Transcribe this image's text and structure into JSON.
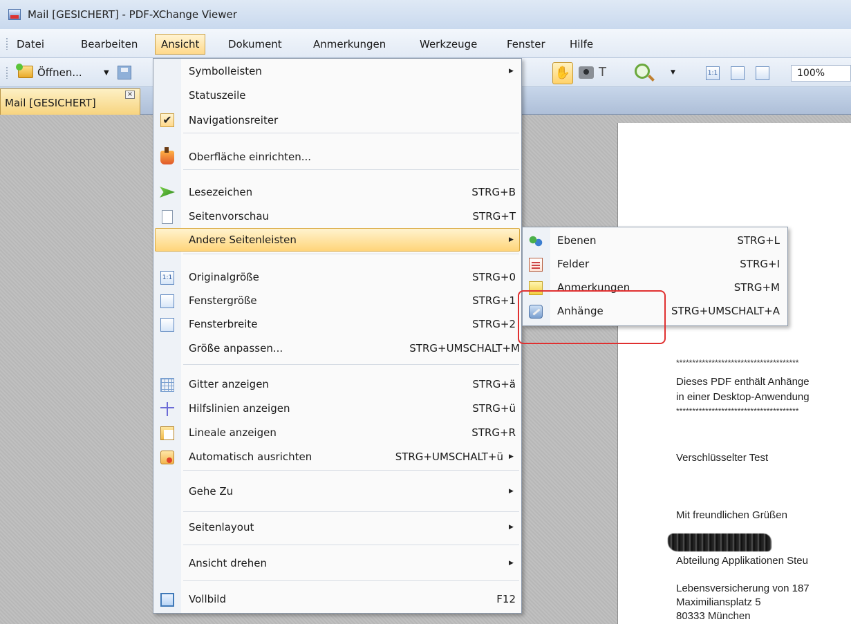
{
  "window": {
    "title": "Mail [GESICHERT] - PDF-XChange Viewer"
  },
  "menubar": {
    "items": [
      {
        "label": "Datei"
      },
      {
        "label": "Bearbeiten"
      },
      {
        "label": "Ansicht"
      },
      {
        "label": "Dokument"
      },
      {
        "label": "Anmerkungen"
      },
      {
        "label": "Werkzeuge"
      },
      {
        "label": "Fenster"
      },
      {
        "label": "Hilfe"
      }
    ],
    "active": "Ansicht"
  },
  "toolbar": {
    "open_label": "Öffnen...",
    "zoom_value": "100%",
    "size_1to1": "1:1"
  },
  "tab": {
    "label": "Mail [GESICHERT]",
    "close_glyph": "×"
  },
  "view_menu": {
    "items": [
      {
        "label": "Symbolleisten",
        "shortcut": "",
        "submenu": true,
        "icon": ""
      },
      {
        "label": "Statuszeile",
        "shortcut": "",
        "submenu": false,
        "icon": ""
      },
      {
        "label": "Navigationsreiter",
        "shortcut": "",
        "submenu": false,
        "icon": "check-icon",
        "checked": true
      },
      {
        "label": "Oberfläche einrichten...",
        "shortcut": "",
        "submenu": false,
        "icon": "paint-bucket-icon"
      },
      {
        "label": "Lesezeichen",
        "shortcut": "STRG+B",
        "submenu": false,
        "icon": "bookmark-icon"
      },
      {
        "label": "Seitenvorschau",
        "shortcut": "STRG+T",
        "submenu": false,
        "icon": "page-icon"
      },
      {
        "label": "Andere Seitenleisten",
        "shortcut": "",
        "submenu": true,
        "icon": "",
        "highlighted": true
      },
      {
        "label": "Originalgröße",
        "shortcut": "STRG+0",
        "submenu": false,
        "icon": "actual-size-icon"
      },
      {
        "label": "Fenstergröße",
        "shortcut": "STRG+1",
        "submenu": false,
        "icon": "fit-window-icon"
      },
      {
        "label": "Fensterbreite",
        "shortcut": "STRG+2",
        "submenu": false,
        "icon": "fit-width-icon"
      },
      {
        "label": "Größe anpassen...",
        "shortcut": "STRG+UMSCHALT+M",
        "submenu": false,
        "icon": ""
      },
      {
        "label": "Gitter anzeigen",
        "shortcut": "STRG+ä",
        "submenu": false,
        "icon": "grid-icon"
      },
      {
        "label": "Hilfslinien anzeigen",
        "shortcut": "STRG+ü",
        "submenu": false,
        "icon": "guides-icon"
      },
      {
        "label": "Lineale anzeigen",
        "shortcut": "STRG+R",
        "submenu": false,
        "icon": "ruler-icon"
      },
      {
        "label": "Automatisch ausrichten",
        "shortcut": "STRG+UMSCHALT+ü",
        "submenu": true,
        "icon": "snap-icon"
      },
      {
        "label": "Gehe Zu",
        "shortcut": "",
        "submenu": true,
        "icon": ""
      },
      {
        "label": "Seitenlayout",
        "shortcut": "",
        "submenu": true,
        "icon": ""
      },
      {
        "label": "Ansicht drehen",
        "shortcut": "",
        "submenu": true,
        "icon": ""
      },
      {
        "label": "Vollbild",
        "shortcut": "F12",
        "submenu": false,
        "icon": "fullscreen-icon"
      }
    ]
  },
  "submenu": {
    "items": [
      {
        "label": "Ebenen",
        "shortcut": "STRG+L",
        "icon": "layers-icon"
      },
      {
        "label": "Felder",
        "shortcut": "STRG+I",
        "icon": "fields-icon"
      },
      {
        "label": "Anmerkungen",
        "shortcut": "STRG+M",
        "icon": "comments-icon"
      },
      {
        "label": "Anhänge",
        "shortcut": "STRG+UMSCHALT+A",
        "icon": "attachments-icon",
        "circled": true
      }
    ]
  },
  "document": {
    "stars_line": "**************************************",
    "notice_line1": "Dieses PDF enthält Anhänge",
    "notice_line2": " in einer Desktop-Anwendung",
    "subject": "Verschlüsselter Test",
    "greeting": "Mit freundlichen Grüßen",
    "department": "Abteilung Applikationen Steu",
    "company": "Lebensversicherung von 187",
    "street": "Maximiliansplatz 5",
    "city": "80333 München"
  },
  "colors": {
    "highlight": "#ffd57a",
    "annotation_circle": "#e03030",
    "menu_active": "#f7d47f"
  }
}
